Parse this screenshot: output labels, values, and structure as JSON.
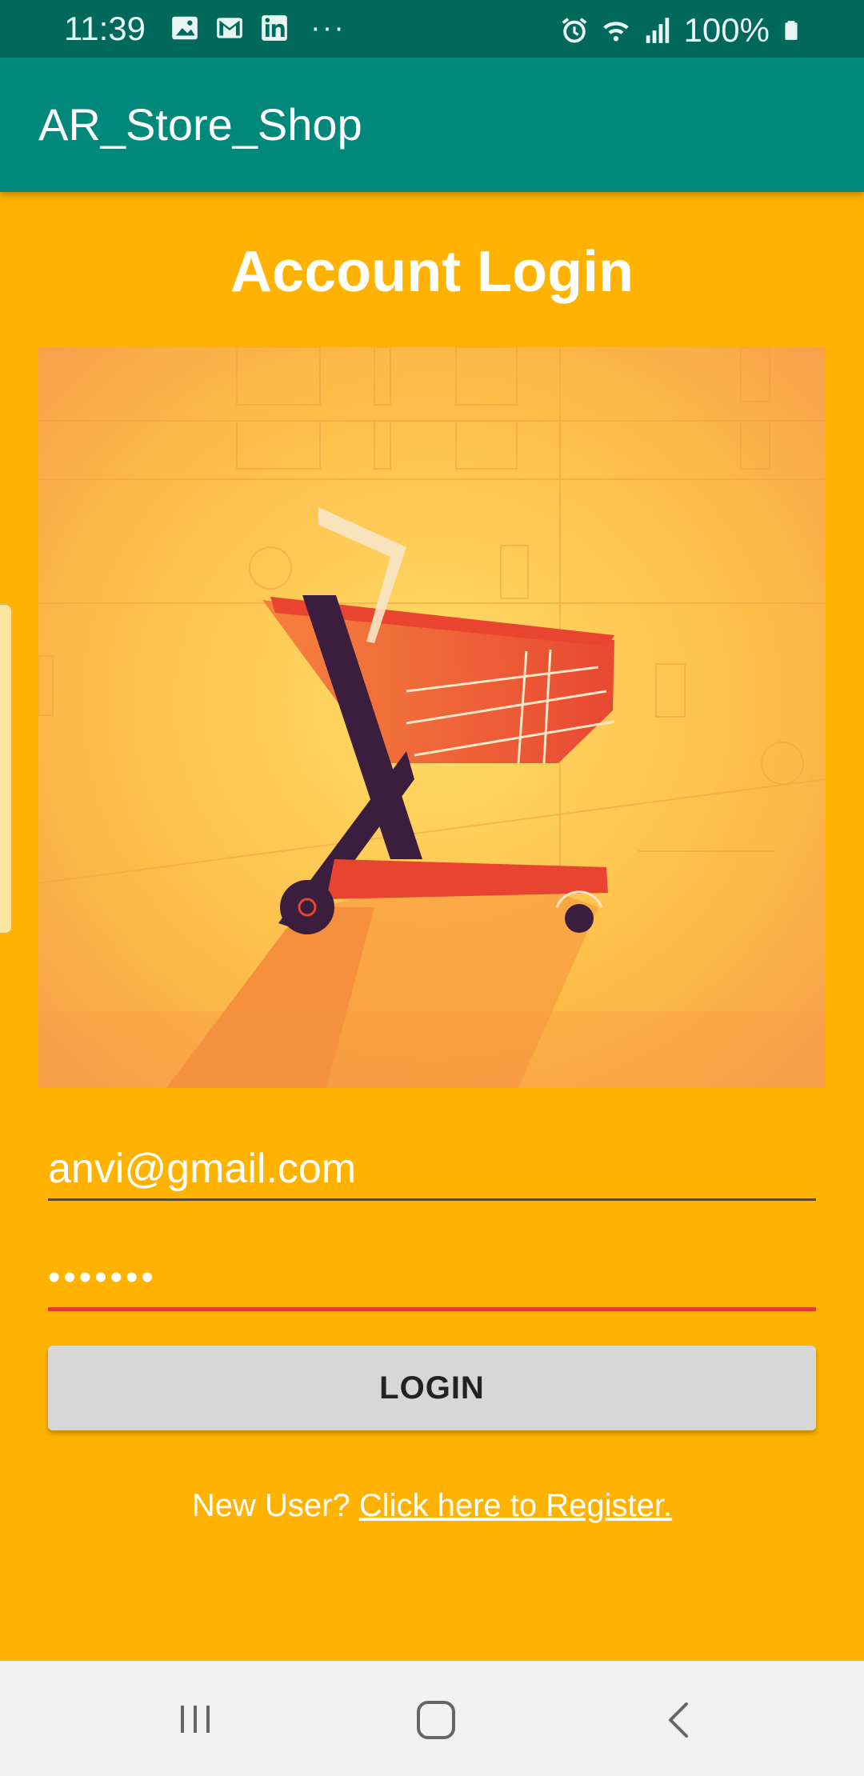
{
  "status_bar": {
    "time": "11:39",
    "battery_percent": "100%",
    "icons": [
      "image-icon",
      "gmail-icon",
      "linkedin-icon",
      "more-icon",
      "alarm-icon",
      "wifi-icon",
      "signal-icon",
      "battery-icon"
    ]
  },
  "app_bar": {
    "title": "AR_Store_Shop"
  },
  "login": {
    "heading": "Account Login",
    "email_value": "anvi@gmail.com",
    "password_value": "•••••••",
    "button_label": "LOGIN",
    "register_prompt": "New User? ",
    "register_link": "Click here to Register."
  },
  "colors": {
    "background": "#FFB300",
    "status_bar": "#00695C",
    "app_bar": "#00897B",
    "accent": "#E53935",
    "button": "#D7D7D7"
  },
  "nav_bar": {
    "buttons": [
      "recents-icon",
      "home-icon",
      "back-icon"
    ]
  }
}
